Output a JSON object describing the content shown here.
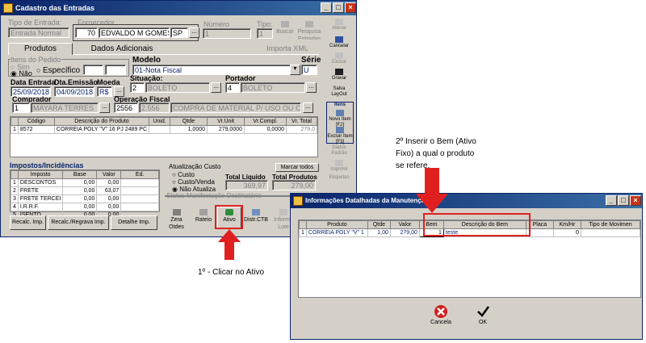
{
  "main": {
    "title": "Cadastro das Entradas",
    "tipo_entrada": {
      "label": "Tipo de Entrada:",
      "value": "Entrada Normal"
    },
    "fornecedor": {
      "label": "Fornecedor",
      "code": "70",
      "name": "EDVALDO M GOMES I",
      "uf": "SP"
    },
    "numero": {
      "label": "Número",
      "value": "1"
    },
    "tipo": {
      "label": "Tipo:",
      "value": "1"
    },
    "buscar": "Buscar",
    "pesquisa_entradas": "Pesquisa Entradas",
    "tabs": [
      "Produtos",
      "Dados Adicionais",
      "Importa XML"
    ],
    "itens_pedido": {
      "label": "Itens do Pedido",
      "opt1": "Sim",
      "opt2": "Não",
      "especifico": "Específico"
    },
    "modelo": {
      "label": "Modelo",
      "value": "01-Nota Fiscal"
    },
    "serie": {
      "label": "Série",
      "value": "U"
    },
    "data_entrada": {
      "label": "Data Entrada",
      "value": "25/09/2018"
    },
    "dta_emissao": {
      "label": "Dta.Emissão",
      "value": "04/09/2018"
    },
    "moeda": {
      "label": "Moeda",
      "value": "R$"
    },
    "situacao": {
      "label": "Situação:",
      "code": "2",
      "value": "BOLETO"
    },
    "portador": {
      "label": "Portador",
      "code": "4",
      "value": "BOLETO"
    },
    "comprador": {
      "label": "Comprador",
      "code": "1",
      "value": "MAYARA TERRES"
    },
    "operacao": {
      "label": "Operação Fiscal",
      "code": "2556",
      "cfop": "2.556",
      "desc": "COMPRA DE MATERIAL P/ USO OU CONS"
    },
    "items_table": {
      "headers": [
        "Código",
        "Descrição do Produto",
        "Unid.",
        "Qtde",
        "Vr.Unit",
        "Vr.Compl.",
        "Vr. Total"
      ],
      "rows": [
        [
          "1",
          "8572",
          "CORREIA POLY \"V\" 16 PJ 2489 PC",
          "",
          "1,0000",
          "279,0000",
          "0,0000",
          "279,0"
        ]
      ]
    },
    "impostos": {
      "label": "Impostos/Incidências",
      "headers": [
        "Imposto",
        "Base",
        "Valor",
        "Ed."
      ],
      "rows": [
        [
          "1",
          "DESCONTOS",
          "0,00",
          "0,00"
        ],
        [
          "2",
          "FRETE",
          "0,00",
          "63,07"
        ],
        [
          "3",
          "FRETE TERCEI",
          "0,00",
          "0,00"
        ],
        [
          "4",
          "I.R.R.F.",
          "0,00",
          "0,00"
        ],
        [
          "5",
          "ISENTO",
          "0,00",
          "0,00"
        ]
      ]
    },
    "atualizacao": {
      "label": "Atualização Custo",
      "opts": [
        "Custo",
        "Custo/Venda",
        "Não Atualiza"
      ]
    },
    "marcar_todos": "Marcar todos",
    "total_liquido": {
      "label": "Total Líquido",
      "value": "369,97"
    },
    "total_produtos": {
      "label": "Total Produtos",
      "value": "279,00"
    },
    "status_manifestacao": "Status Manifestação Destinatário",
    "bottom_buttons": [
      "Recalc. Imp.",
      "Recalc./Regrava Imp.",
      "Detalhe Imp."
    ],
    "toolbar": [
      "Zera Qtdes",
      "Rateio",
      "Ativo",
      "Distr.CTB",
      "Informa Lote"
    ],
    "side": [
      "Alterar",
      "Cancelar",
      "Excluir",
      "Gravar",
      "Salva LayOut",
      "Itens",
      "Novo Item [F2]",
      "Excluir Item [F3]",
      "Dados Padrão",
      "Imprimir",
      "Etiquetas"
    ]
  },
  "dialog": {
    "title": "Informações Datalhadas da Manutenção do",
    "headers": [
      "Produto",
      "Qtde",
      "Valor",
      "Bem",
      "Descrição do Bem",
      "Placa",
      "Km/Hr",
      "Tipo de Movimen"
    ],
    "row": [
      "1",
      "CORREIA POLY \"V\" 1",
      "1,00",
      "279,00",
      "1",
      "teste",
      "",
      "0",
      ""
    ],
    "cancel": "Cancela",
    "ok": "OK"
  },
  "annotations": {
    "step1": "1º - Clicar no Ativo",
    "step2": "2º Inserir o Bem (Ativo Fixo) a qual o produto se refere."
  },
  "colors": {
    "annotation": "#e02020",
    "titlebar": "#0a246a",
    "selection": "#0a246a"
  }
}
